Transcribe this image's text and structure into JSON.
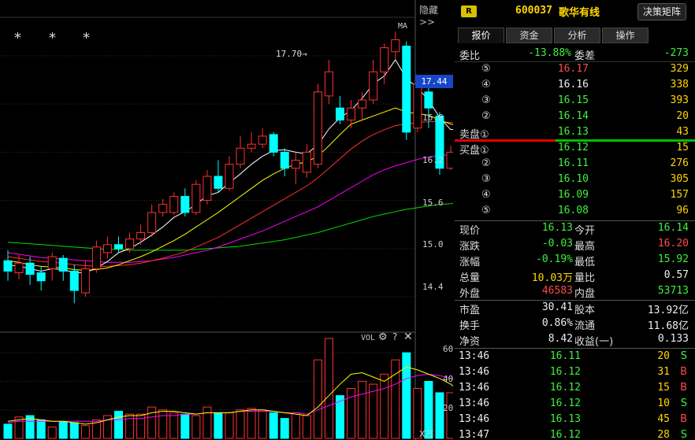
{
  "header": {
    "badge": "R",
    "code": "600037",
    "name": "歌华有线",
    "decision_btn": "决策矩阵",
    "hide_btn": "隐藏>>"
  },
  "tabs": [
    {
      "label": "报价",
      "active": true
    },
    {
      "label": "资金",
      "active": false
    },
    {
      "label": "分析",
      "active": false
    },
    {
      "label": "操作",
      "active": false
    }
  ],
  "quote": {
    "ratio_label": "委比",
    "ratio_value": "-13.88%",
    "diff_label": "委差",
    "diff_value": "-273",
    "asks": [
      {
        "level": "⑤",
        "price": "16.17",
        "volume": "329",
        "color": "red"
      },
      {
        "level": "④",
        "price": "16.16",
        "volume": "338",
        "color": "white"
      },
      {
        "level": "③",
        "price": "16.15",
        "volume": "393",
        "color": "green"
      },
      {
        "level": "②",
        "price": "16.14",
        "volume": "20",
        "color": "green"
      },
      {
        "level": "卖盘①",
        "price": "16.13",
        "volume": "43",
        "color": "green"
      }
    ],
    "bids": [
      {
        "level": "买盘①",
        "price": "16.12",
        "volume": "15",
        "color": "green"
      },
      {
        "level": "②",
        "price": "16.11",
        "volume": "276",
        "color": "green"
      },
      {
        "level": "③",
        "price": "16.10",
        "volume": "305",
        "color": "green"
      },
      {
        "level": "④",
        "price": "16.09",
        "volume": "157",
        "color": "green"
      },
      {
        "level": "⑤",
        "price": "16.08",
        "volume": "96",
        "color": "green"
      }
    ]
  },
  "stats": [
    {
      "l1": "现价",
      "v1": "16.13",
      "c1": "green",
      "l2": "今开",
      "v2": "16.14",
      "c2": "green"
    },
    {
      "l1": "涨跌",
      "v1": "-0.03",
      "c1": "green",
      "l2": "最高",
      "v2": "16.20",
      "c2": "red"
    },
    {
      "l1": "涨幅",
      "v1": "-0.19%",
      "c1": "green",
      "l2": "最低",
      "v2": "15.92",
      "c2": "green"
    },
    {
      "l1": "总量",
      "v1": "10.03万",
      "c1": "yellow",
      "l2": "量比",
      "v2": "0.57",
      "c2": "white"
    },
    {
      "l1": "外盘",
      "v1": "46583",
      "c1": "red",
      "l2": "内盘",
      "v2": "53713",
      "c2": "green"
    }
  ],
  "fundamentals": [
    {
      "l1": "市盈",
      "v1": "30.41",
      "l2": "股本",
      "v2": "13.92亿"
    },
    {
      "l1": "换手",
      "v1": "0.86%",
      "l2": "流通",
      "v2": "11.68亿"
    },
    {
      "l1": "净资",
      "v1": "8.42",
      "l2": "收益(一)",
      "v2": "0.133"
    }
  ],
  "ticks": [
    {
      "time": "13:46",
      "price": "16.11",
      "vol": "20",
      "side": "S"
    },
    {
      "time": "13:46",
      "price": "16.12",
      "vol": "31",
      "side": "B"
    },
    {
      "time": "13:46",
      "price": "16.12",
      "vol": "15",
      "side": "B"
    },
    {
      "time": "13:46",
      "price": "16.12",
      "vol": "10",
      "side": "S"
    },
    {
      "time": "13:46",
      "price": "16.13",
      "vol": "45",
      "side": "B"
    },
    {
      "time": "13:47",
      "price": "16.12",
      "vol": "28",
      "side": "S"
    }
  ],
  "chart_labels": {
    "ma": "MA",
    "current_price": "17.44",
    "peak": "17.70",
    "y_ticks": [
      "16.8",
      "16.2",
      "15.6",
      "15.0",
      "14.4"
    ],
    "vol_label": "VOL",
    "vol_ticks": [
      "60",
      "40",
      "20"
    ],
    "vol_unit": "X万",
    "stars": [
      "*",
      "*",
      "*"
    ]
  },
  "colors": {
    "up": "#ff3030",
    "down": "#00ffff",
    "ma5": "#ffffff",
    "ma10": "#ffff00",
    "ma20": "#ff3030",
    "ma30": "#ff00ff",
    "ma60": "#00dd00",
    "grid": "#2b2b2b"
  },
  "chart_data": {
    "type": "candlestick",
    "y_range": [
      14.0,
      17.8
    ],
    "candles": [
      {
        "o": 14.85,
        "c": 14.72,
        "h": 14.98,
        "l": 14.6
      },
      {
        "o": 14.7,
        "c": 14.82,
        "h": 14.92,
        "l": 14.62
      },
      {
        "o": 14.82,
        "c": 14.68,
        "h": 14.9,
        "l": 14.55
      },
      {
        "o": 14.7,
        "c": 14.6,
        "h": 14.78,
        "l": 14.48
      },
      {
        "o": 14.75,
        "c": 14.9,
        "h": 14.95,
        "l": 14.6
      },
      {
        "o": 14.88,
        "c": 14.72,
        "h": 14.92,
        "l": 14.6
      },
      {
        "o": 14.72,
        "c": 14.48,
        "h": 14.8,
        "l": 14.32
      },
      {
        "o": 14.45,
        "c": 14.75,
        "h": 14.85,
        "l": 14.4
      },
      {
        "o": 14.75,
        "c": 15.02,
        "h": 15.1,
        "l": 14.7
      },
      {
        "o": 14.95,
        "c": 15.05,
        "h": 15.15,
        "l": 14.88
      },
      {
        "o": 15.05,
        "c": 15.0,
        "h": 15.15,
        "l": 14.95
      },
      {
        "o": 15.0,
        "c": 15.12,
        "h": 15.2,
        "l": 14.95
      },
      {
        "o": 15.12,
        "c": 15.2,
        "h": 15.3,
        "l": 15.05
      },
      {
        "o": 15.2,
        "c": 15.45,
        "h": 15.55,
        "l": 15.15
      },
      {
        "o": 15.45,
        "c": 15.55,
        "h": 15.62,
        "l": 15.4
      },
      {
        "o": 15.45,
        "c": 15.65,
        "h": 15.7,
        "l": 15.42
      },
      {
        "o": 15.65,
        "c": 15.45,
        "h": 15.75,
        "l": 15.4
      },
      {
        "o": 15.45,
        "c": 15.8,
        "h": 15.85,
        "l": 15.42
      },
      {
        "o": 15.6,
        "c": 15.9,
        "h": 15.98,
        "l": 15.55
      },
      {
        "o": 15.9,
        "c": 15.75,
        "h": 16.1,
        "l": 15.7
      },
      {
        "o": 15.75,
        "c": 16.05,
        "h": 16.15,
        "l": 15.72
      },
      {
        "o": 16.05,
        "c": 16.25,
        "h": 16.4,
        "l": 16.0
      },
      {
        "o": 16.25,
        "c": 16.3,
        "h": 16.45,
        "l": 16.2
      },
      {
        "o": 16.3,
        "c": 16.4,
        "h": 16.5,
        "l": 16.25
      },
      {
        "o": 16.42,
        "c": 16.2,
        "h": 16.45,
        "l": 16.15
      },
      {
        "o": 16.2,
        "c": 16.0,
        "h": 16.25,
        "l": 15.9
      },
      {
        "o": 16.0,
        "c": 16.1,
        "h": 16.2,
        "l": 15.8
      },
      {
        "o": 15.95,
        "c": 16.2,
        "h": 16.3,
        "l": 15.88
      },
      {
        "o": 16.05,
        "c": 16.95,
        "h": 17.05,
        "l": 16.0
      },
      {
        "o": 16.9,
        "c": 17.2,
        "h": 17.35,
        "l": 16.8
      },
      {
        "o": 16.75,
        "c": 16.6,
        "h": 16.9,
        "l": 16.55
      },
      {
        "o": 16.6,
        "c": 16.75,
        "h": 16.85,
        "l": 16.5
      },
      {
        "o": 16.75,
        "c": 16.85,
        "h": 16.95,
        "l": 16.6
      },
      {
        "o": 16.85,
        "c": 17.2,
        "h": 17.35,
        "l": 16.8
      },
      {
        "o": 17.2,
        "c": 17.5,
        "h": 17.55,
        "l": 17.05
      },
      {
        "o": 17.45,
        "c": 17.6,
        "h": 17.7,
        "l": 17.35
      },
      {
        "o": 17.52,
        "c": 16.45,
        "h": 17.58,
        "l": 16.35
      },
      {
        "o": 16.5,
        "c": 17.05,
        "h": 17.1,
        "l": 16.45
      },
      {
        "o": 16.95,
        "c": 16.75,
        "h": 17.05,
        "l": 16.5
      },
      {
        "o": 16.65,
        "c": 16.0,
        "h": 16.7,
        "l": 15.92
      },
      {
        "o": 16.0,
        "c": 16.2,
        "h": 16.28,
        "l": 15.98
      },
      {
        "o": 16.18,
        "c": 16.14,
        "h": 16.25,
        "l": 16.05
      },
      {
        "o": 16.14,
        "c": 16.13,
        "h": 16.2,
        "l": 15.92
      }
    ],
    "volume": [
      10,
      15,
      16,
      13,
      8,
      12,
      11,
      9,
      13,
      16,
      19,
      17,
      17,
      22,
      20,
      18,
      17,
      16,
      22,
      18,
      18,
      20,
      21,
      20,
      18,
      14,
      18,
      16,
      55,
      70,
      30,
      35,
      40,
      38,
      45,
      55,
      60,
      35,
      40,
      32,
      32,
      28,
      10
    ],
    "vol_range": [
      0,
      70
    ],
    "ma5": [
      14.8,
      14.78,
      14.75,
      14.72,
      14.75,
      14.74,
      14.7,
      14.7,
      14.76,
      14.84,
      14.95,
      15.0,
      15.08,
      15.17,
      15.27,
      15.39,
      15.46,
      15.55,
      15.66,
      15.7,
      15.82,
      15.93,
      16.05,
      16.15,
      16.22,
      16.23,
      16.2,
      16.18,
      16.29,
      16.49,
      16.63,
      16.72,
      16.87,
      17.05,
      17.15,
      17.35,
      17.12,
      17.0,
      16.85,
      16.63,
      16.48,
      16.5,
      16.25
    ],
    "ma10": [
      14.85,
      14.83,
      14.8,
      14.78,
      14.77,
      14.76,
      14.74,
      14.73,
      14.74,
      14.76,
      14.8,
      14.85,
      14.9,
      14.96,
      15.03,
      15.1,
      15.18,
      15.27,
      15.36,
      15.45,
      15.55,
      15.65,
      15.75,
      15.85,
      15.93,
      16.0,
      16.05,
      16.08,
      16.15,
      16.28,
      16.42,
      16.55,
      16.6,
      16.65,
      16.7,
      16.75,
      16.7,
      16.68,
      16.66,
      16.6,
      16.55,
      16.52,
      16.48
    ],
    "ma20": [
      14.9,
      14.88,
      14.86,
      14.84,
      14.83,
      14.82,
      14.8,
      14.79,
      14.78,
      14.78,
      14.79,
      14.8,
      14.82,
      14.85,
      14.88,
      14.92,
      14.96,
      15.02,
      15.08,
      15.14,
      15.22,
      15.3,
      15.38,
      15.46,
      15.54,
      15.62,
      15.7,
      15.78,
      15.88,
      16.0,
      16.12,
      16.24,
      16.34,
      16.42,
      16.48,
      16.53,
      16.55,
      16.57,
      16.58,
      16.58,
      16.57,
      16.56,
      16.55
    ],
    "ma30": [
      14.95,
      14.93,
      14.91,
      14.89,
      14.88,
      14.87,
      14.86,
      14.85,
      14.84,
      14.83,
      14.83,
      14.83,
      14.84,
      14.85,
      14.87,
      14.89,
      14.92,
      14.95,
      14.98,
      15.02,
      15.07,
      15.12,
      15.17,
      15.22,
      15.28,
      15.34,
      15.4,
      15.46,
      15.52,
      15.6,
      15.68,
      15.76,
      15.84,
      15.92,
      15.98,
      16.03,
      16.07,
      16.11,
      16.14,
      16.16,
      16.17,
      16.18,
      16.18
    ],
    "ma60": [
      15.08,
      15.07,
      15.06,
      15.05,
      15.04,
      15.03,
      15.02,
      15.01,
      15.0,
      14.99,
      14.99,
      14.98,
      14.98,
      14.98,
      14.98,
      14.98,
      14.98,
      14.99,
      15.0,
      15.01,
      15.02,
      15.03,
      15.05,
      15.07,
      15.09,
      15.11,
      15.14,
      15.17,
      15.2,
      15.24,
      15.28,
      15.32,
      15.36,
      15.4,
      15.43,
      15.46,
      15.49,
      15.51,
      15.53,
      15.55,
      15.56,
      15.58,
      15.6
    ],
    "vol_ma5": [
      12,
      13,
      14,
      13,
      12,
      12,
      11,
      10,
      11,
      13,
      15,
      16,
      16,
      18,
      19,
      19,
      18,
      17,
      18,
      18,
      18,
      19,
      20,
      20,
      19,
      18,
      17,
      16,
      22,
      30,
      38,
      45,
      46,
      43,
      40,
      45,
      50,
      48,
      45,
      42,
      38,
      32,
      28
    ],
    "vol_ma10": [
      11,
      12,
      12,
      12,
      12,
      12,
      12,
      12,
      12,
      13,
      13,
      14,
      14,
      15,
      16,
      16,
      17,
      17,
      18,
      18,
      18,
      19,
      19,
      19,
      19,
      18,
      18,
      17,
      20,
      23,
      26,
      29,
      31,
      33,
      35,
      38,
      42,
      44,
      45,
      44,
      42,
      40,
      38
    ]
  }
}
